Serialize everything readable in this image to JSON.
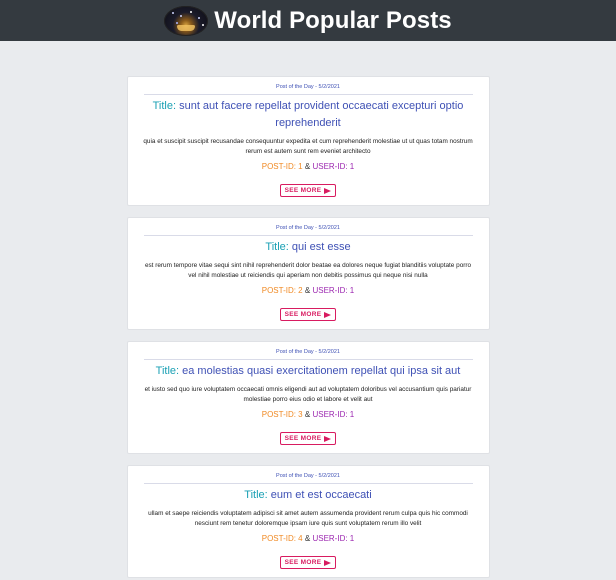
{
  "header": {
    "title": "World Popular Posts",
    "logo_icon": "galaxy-book-logo"
  },
  "colors": {
    "header_bg": "#343a40",
    "page_bg": "#e9ebee",
    "title_label": "#1aa0b4",
    "title_text": "#3f51b5",
    "post_id": "#f08a24",
    "user_id": "#9c27b0",
    "button": "#d81b60"
  },
  "posts": [
    {
      "meta": "Post of the Day - 5/2/2021",
      "title_label": "Title:",
      "title": "sunt aut facere repellat provident occaecati excepturi optio reprehenderit",
      "body": "quia et suscipit suscipit recusandae consequuntur expedita et cum reprehenderit molestiae ut ut quas totam nostrum rerum est autem sunt rem eveniet architecto",
      "post_id": "POST-ID: 1",
      "amp": "&",
      "user_id": "USER-ID: 1",
      "button_label": "SEE MORE"
    },
    {
      "meta": "Post of the Day - 5/2/2021",
      "title_label": "Title:",
      "title": "qui est esse",
      "body": "est rerum tempore vitae sequi sint nihil reprehenderit dolor beatae ea dolores neque fugiat blanditiis voluptate porro vel nihil molestiae ut reiciendis qui aperiam non debitis possimus qui neque nisi nulla",
      "post_id": "POST-ID: 2",
      "amp": "&",
      "user_id": "USER-ID: 1",
      "button_label": "SEE MORE"
    },
    {
      "meta": "Post of the Day - 5/2/2021",
      "title_label": "Title:",
      "title": "ea molestias quasi exercitationem repellat qui ipsa sit aut",
      "body": "et iusto sed quo iure voluptatem occaecati omnis eligendi aut ad voluptatem doloribus vel accusantium quis pariatur molestiae porro eius odio et labore et velit aut",
      "post_id": "POST-ID: 3",
      "amp": "&",
      "user_id": "USER-ID: 1",
      "button_label": "SEE MORE"
    },
    {
      "meta": "Post of the Day - 5/2/2021",
      "title_label": "Title:",
      "title": "eum et est occaecati",
      "body": "ullam et saepe reiciendis voluptatem adipisci sit amet autem assumenda provident rerum culpa quis hic commodi nesciunt rem tenetur doloremque ipsam iure quis sunt voluptatem rerum illo velit",
      "post_id": "POST-ID: 4",
      "amp": "&",
      "user_id": "USER-ID: 1",
      "button_label": "SEE MORE"
    }
  ]
}
